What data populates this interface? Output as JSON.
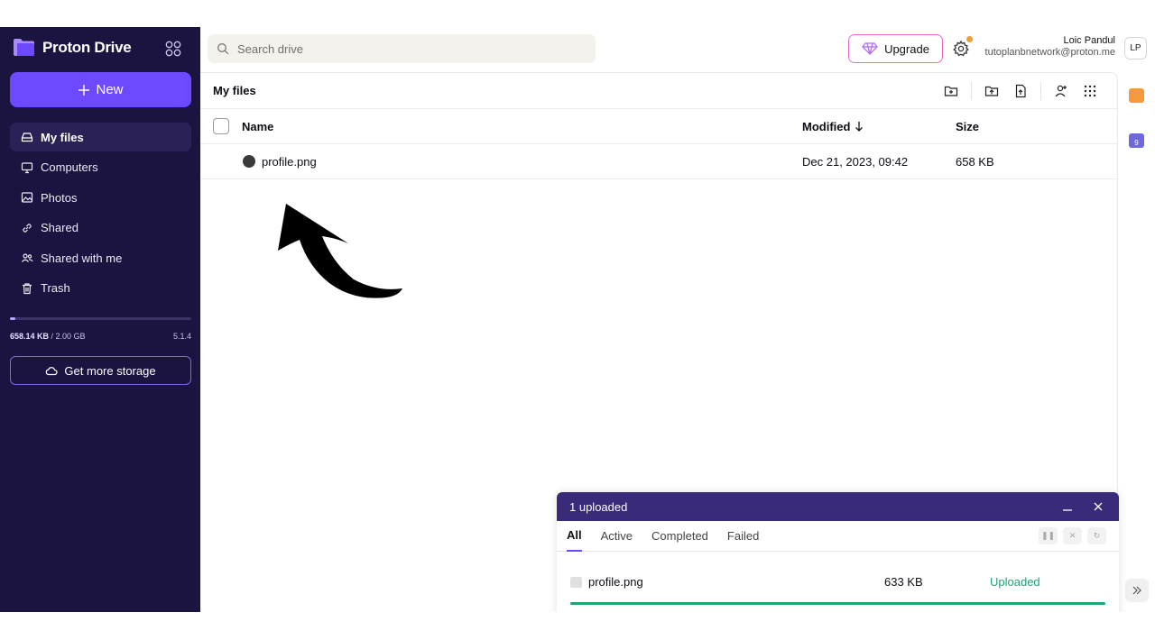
{
  "app": {
    "name": "Proton Drive"
  },
  "sidebar": {
    "new_label": "New",
    "items": [
      {
        "label": "My files",
        "icon": "hard-drive-icon",
        "active": true
      },
      {
        "label": "Computers",
        "icon": "monitor-icon",
        "active": false
      },
      {
        "label": "Photos",
        "icon": "image-icon",
        "active": false
      },
      {
        "label": "Shared",
        "icon": "link-icon",
        "active": false
      },
      {
        "label": "Shared with me",
        "icon": "users-icon",
        "active": false
      },
      {
        "label": "Trash",
        "icon": "trash-icon",
        "active": false
      }
    ],
    "storage_used": "658.14 KB",
    "storage_total": " / 2.00 GB",
    "storage_fraction": 0.03,
    "version": "5.1.4",
    "get_storage_label": "Get more storage"
  },
  "topbar": {
    "search_placeholder": "Search drive",
    "upgrade_label": "Upgrade",
    "user_name": "Loic Pandul",
    "user_email": "tutoplanbnetwork@proton.me",
    "avatar_initials": "LP",
    "badge_count": "9"
  },
  "main": {
    "breadcrumb": "My files",
    "columns": {
      "name": "Name",
      "modified": "Modified",
      "size": "Size"
    },
    "rows": [
      {
        "name": "profile.png",
        "modified": "Dec 21, 2023, 09:42",
        "size": "658 KB"
      }
    ]
  },
  "transfer": {
    "title": "1 uploaded",
    "tabs": [
      "All",
      "Active",
      "Completed",
      "Failed"
    ],
    "active_tab": "All",
    "items": [
      {
        "name": "profile.png",
        "size": "633 KB",
        "status": "Uploaded",
        "progress": 1.0
      }
    ]
  },
  "colors": {
    "sidebar_bg": "#1b1340",
    "accent": "#6d4aff",
    "transfer_header": "#3b2a7a",
    "success": "#1ea672"
  }
}
